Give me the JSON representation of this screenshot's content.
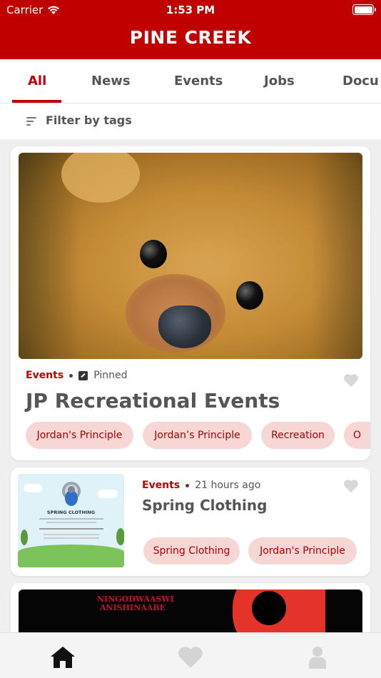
{
  "status": {
    "carrier": "Carrier",
    "time": "1:53 PM"
  },
  "app": {
    "title": "PINE CREEK",
    "accent": "#c00000",
    "chip_bg": "#f7d6d6"
  },
  "tabs": [
    {
      "label": "All",
      "active": true
    },
    {
      "label": "News"
    },
    {
      "label": "Events"
    },
    {
      "label": "Jobs"
    },
    {
      "label": "Docu"
    }
  ],
  "filter": {
    "label": "Filter by tags",
    "icon": "filter-icon"
  },
  "posts": [
    {
      "category": "Events",
      "status": "Pinned",
      "title": "JP Recreational Events",
      "image": "teddy-bear-photo",
      "tags": [
        "Jordan's Principle",
        "Jordan’s Principle",
        "Recreation",
        "O"
      ]
    },
    {
      "category": "Events",
      "time": "21 hours ago",
      "title": "Spring Clothing",
      "image": "spring-clothing-poster",
      "poster_heading": "SPRING CLOTHING",
      "tags": [
        "Spring Clothing",
        "Jordan's Principle"
      ]
    },
    {
      "banner_text": "NINGODWAASWI ANISHINAABE"
    }
  ],
  "bottom_nav": [
    {
      "icon": "home-icon",
      "active": true
    },
    {
      "icon": "heart-icon"
    },
    {
      "icon": "profile-icon"
    }
  ]
}
